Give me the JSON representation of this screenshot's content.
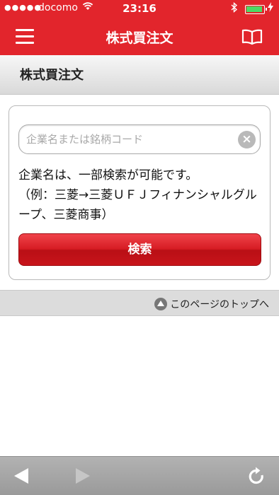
{
  "status_bar": {
    "signal": "●●●●●",
    "carrier": "docomo",
    "time": "23:16"
  },
  "header": {
    "title": "株式買注文",
    "menu_icon": "hamburger-menu-icon",
    "guide_icon": "open-book-icon",
    "color": "#e2252c"
  },
  "page": {
    "heading": "株式買注文"
  },
  "search": {
    "placeholder": "企業名または銘柄コード",
    "value": "",
    "clear_icon": "clear-x-icon",
    "hint_line1": "企業名は、一部検索が可能です。",
    "hint_line2": "（例：三菱→三菱ＵＦＪフィナンシャルグループ、三菱商事）",
    "button_label": "検索"
  },
  "page_top": {
    "label": "このページのトップへ",
    "icon": "up-arrow-circle-icon"
  },
  "toolbar": {
    "back_icon": "back-arrow-icon",
    "forward_icon": "forward-arrow-icon",
    "reload_icon": "reload-icon"
  }
}
